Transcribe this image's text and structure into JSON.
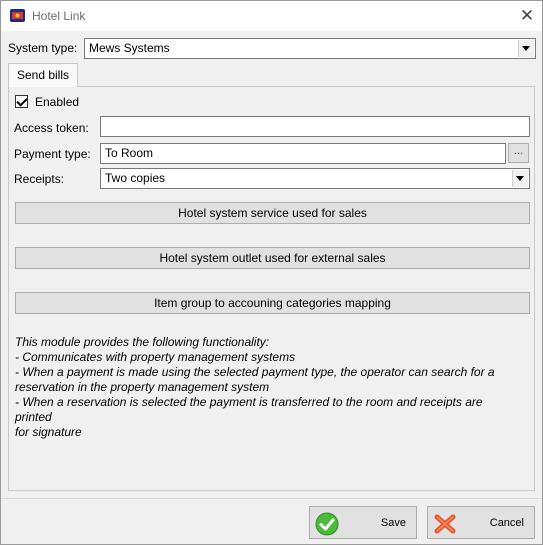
{
  "window": {
    "title": "Hotel Link",
    "icon": "app-icon",
    "close_icon": "close-icon"
  },
  "system_type": {
    "label": "System type:",
    "value": "Mews Systems"
  },
  "tabs": [
    {
      "label": "Send bills"
    }
  ],
  "send_bills": {
    "enabled": {
      "label": "Enabled",
      "checked": true
    },
    "access_token": {
      "label": "Access token:",
      "value": ""
    },
    "payment_type": {
      "label": "Payment type:",
      "value": "To Room",
      "browse_label": "..."
    },
    "receipts": {
      "label": "Receipts:",
      "value": "Two copies"
    },
    "buttons": {
      "service": "Hotel system service used for sales",
      "outlet": "Hotel system outlet used for external sales",
      "mapping": "Item group to accouning categories mapping"
    },
    "description": "This module provides the following functionality:\n- Communicates with property management systems\n- When a payment is made using the selected payment type, the operator can search for a\nreservation in the property management system\n- When a reservation is selected the payment is transferred to the room and receipts are printed\nfor signature"
  },
  "footer": {
    "save_label": "Save",
    "save_icon": "checkmark-icon",
    "cancel_label": "Cancel",
    "cancel_icon": "cross-icon"
  },
  "colors": {
    "save_icon": "#4cbb3c",
    "cancel_icon": "#e5542a",
    "panel": "#f0f0f0"
  }
}
